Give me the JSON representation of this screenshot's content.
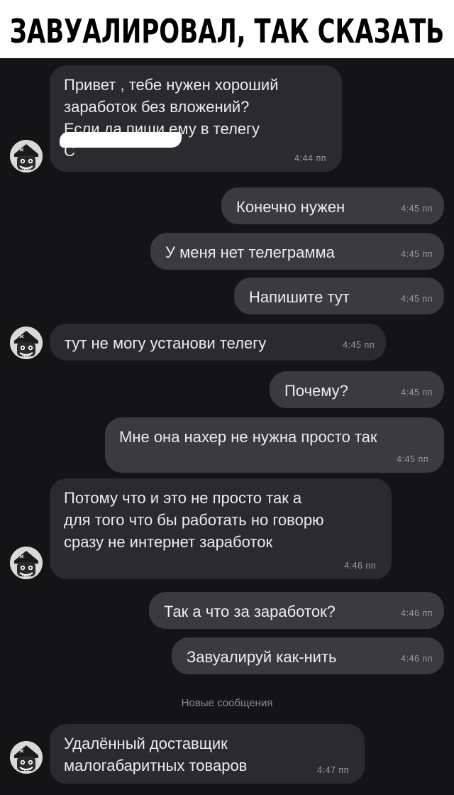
{
  "header": {
    "title": "ЗАВУАЛИРОВАЛ, ТАК СКАЗАТЬ"
  },
  "avatar_icon": "cartoon-character-avatar-icon",
  "colors": {
    "background": "#141416",
    "incoming": "#2b2b2f",
    "outgoing": "#3a3a3f",
    "text": "#ececef",
    "time": "#9a9aa2"
  },
  "messages": [
    {
      "text": "Привет , тебе нужен хороший\nзаработок без вложений?\nЕсли да пиши ему в телегу\nС",
      "time": "4:44 пп"
    },
    {
      "text": "Конечно нужен",
      "time": "4:45 пп"
    },
    {
      "text": "У меня нет телеграмма",
      "time": "4:45 пп"
    },
    {
      "text": "Напишите тут",
      "time": "4:45 пп"
    },
    {
      "text": "тут не могу установи телегу",
      "time": "4:45 пп"
    },
    {
      "text": "Почему?",
      "time": "4:45 пп"
    },
    {
      "text": "Мне она нахер не нужна просто так",
      "time": "4:45 пп"
    },
    {
      "text": "Потому что и это не просто так а\nдля того что бы работать но говорю\nсразу не интернет заработок",
      "time": "4:46 пп"
    },
    {
      "text": "Так а что за заработок?",
      "time": "4:46 пп"
    },
    {
      "text": "Завуалируй как-нить",
      "time": "4:46 пп"
    },
    {
      "text": "Удалённый доставщик\nмалогабаритных товаров",
      "time": "4:47 пп"
    }
  ],
  "divider": {
    "label": "Новые сообщения"
  }
}
